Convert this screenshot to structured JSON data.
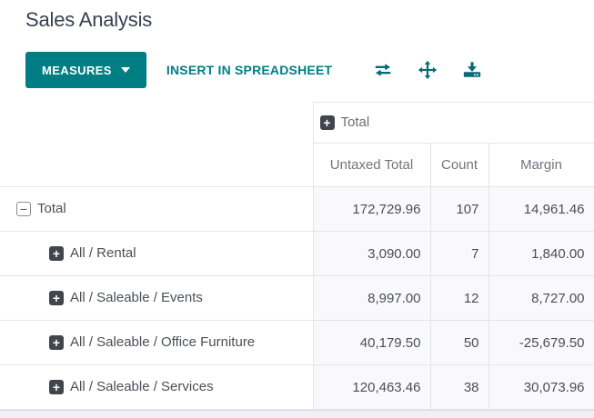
{
  "page": {
    "title": "Sales Analysis"
  },
  "toolbar": {
    "measures_label": "MEASURES",
    "insert_label": "INSERT IN SPREADSHEET",
    "icons": [
      "flip-axes-icon",
      "expand-all-icon",
      "download-icon"
    ]
  },
  "colors": {
    "accent_teal": "#017e84",
    "icon_dark": "#41464d",
    "cell_bg": "#f9f9fb",
    "border": "#e3e5e8"
  },
  "pivot": {
    "column_group": {
      "label": "Total",
      "icon": "plus"
    },
    "measures": [
      "Untaxed Total",
      "Count",
      "Margin"
    ],
    "rows": [
      {
        "label": "Total",
        "icon": "minus",
        "indent": 0,
        "values": [
          "172,729.96",
          "107",
          "14,961.46"
        ]
      },
      {
        "label": "All / Rental",
        "icon": "plus",
        "indent": 1,
        "values": [
          "3,090.00",
          "7",
          "1,840.00"
        ]
      },
      {
        "label": "All / Saleable / Events",
        "icon": "plus",
        "indent": 1,
        "values": [
          "8,997.00",
          "12",
          "8,727.00"
        ]
      },
      {
        "label": "All / Saleable / Office Furniture",
        "icon": "plus",
        "indent": 1,
        "values": [
          "40,179.50",
          "50",
          "-25,679.50"
        ]
      },
      {
        "label": "All / Saleable / Services",
        "icon": "plus",
        "indent": 1,
        "values": [
          "120,463.46",
          "38",
          "30,073.96"
        ]
      }
    ]
  }
}
